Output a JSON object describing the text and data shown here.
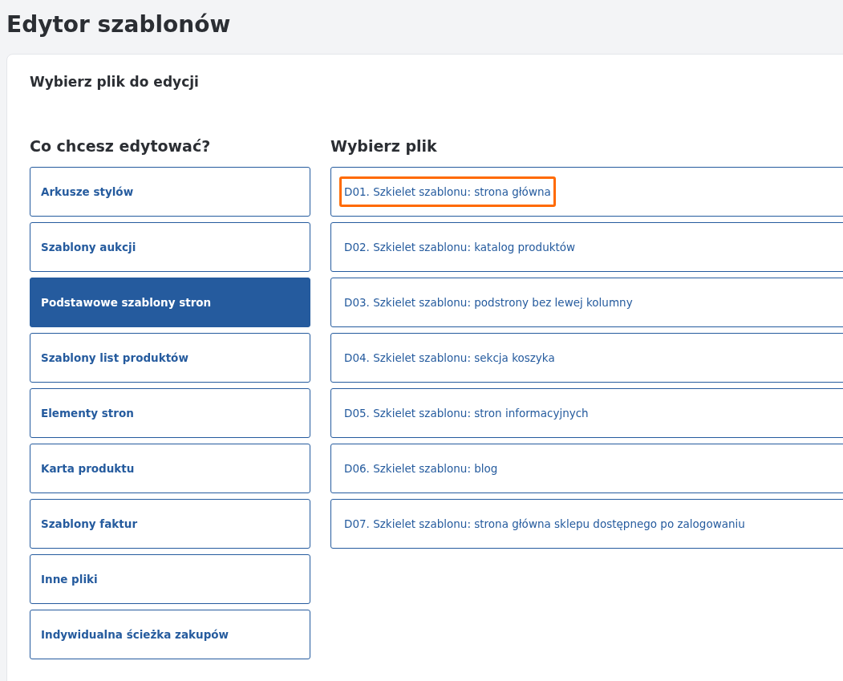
{
  "page_title": "Edytor szablonów",
  "card": {
    "title": "Wybierz plik do edycji",
    "categories": {
      "heading": "Co chcesz edytować?",
      "items": [
        {
          "label": "Arkusze stylów",
          "selected": false
        },
        {
          "label": "Szablony aukcji",
          "selected": false
        },
        {
          "label": "Podstawowe szablony stron",
          "selected": true
        },
        {
          "label": "Szablony list produktów",
          "selected": false
        },
        {
          "label": "Elementy stron",
          "selected": false
        },
        {
          "label": "Karta produktu",
          "selected": false
        },
        {
          "label": "Szablony faktur",
          "selected": false
        },
        {
          "label": "Inne pliki",
          "selected": false
        },
        {
          "label": "Indywidualna ścieżka zakupów",
          "selected": false
        }
      ]
    },
    "files": {
      "heading": "Wybierz plik",
      "items": [
        {
          "label": "D01. Szkielet szablonu: strona główna",
          "highlighted": true
        },
        {
          "label": "D02. Szkielet szablonu: katalog produktów",
          "highlighted": false
        },
        {
          "label": "D03. Szkielet szablonu: podstrony bez lewej kolumny",
          "highlighted": false
        },
        {
          "label": "D04. Szkielet szablonu: sekcja koszyka",
          "highlighted": false
        },
        {
          "label": "D05. Szkielet szablonu: stron informacyjnych",
          "highlighted": false
        },
        {
          "label": "D06. Szkielet szablonu: blog",
          "highlighted": false
        },
        {
          "label": "D07. Szkielet szablonu: strona główna sklepu dostępnego po zalogowaniu",
          "highlighted": false
        }
      ]
    }
  }
}
